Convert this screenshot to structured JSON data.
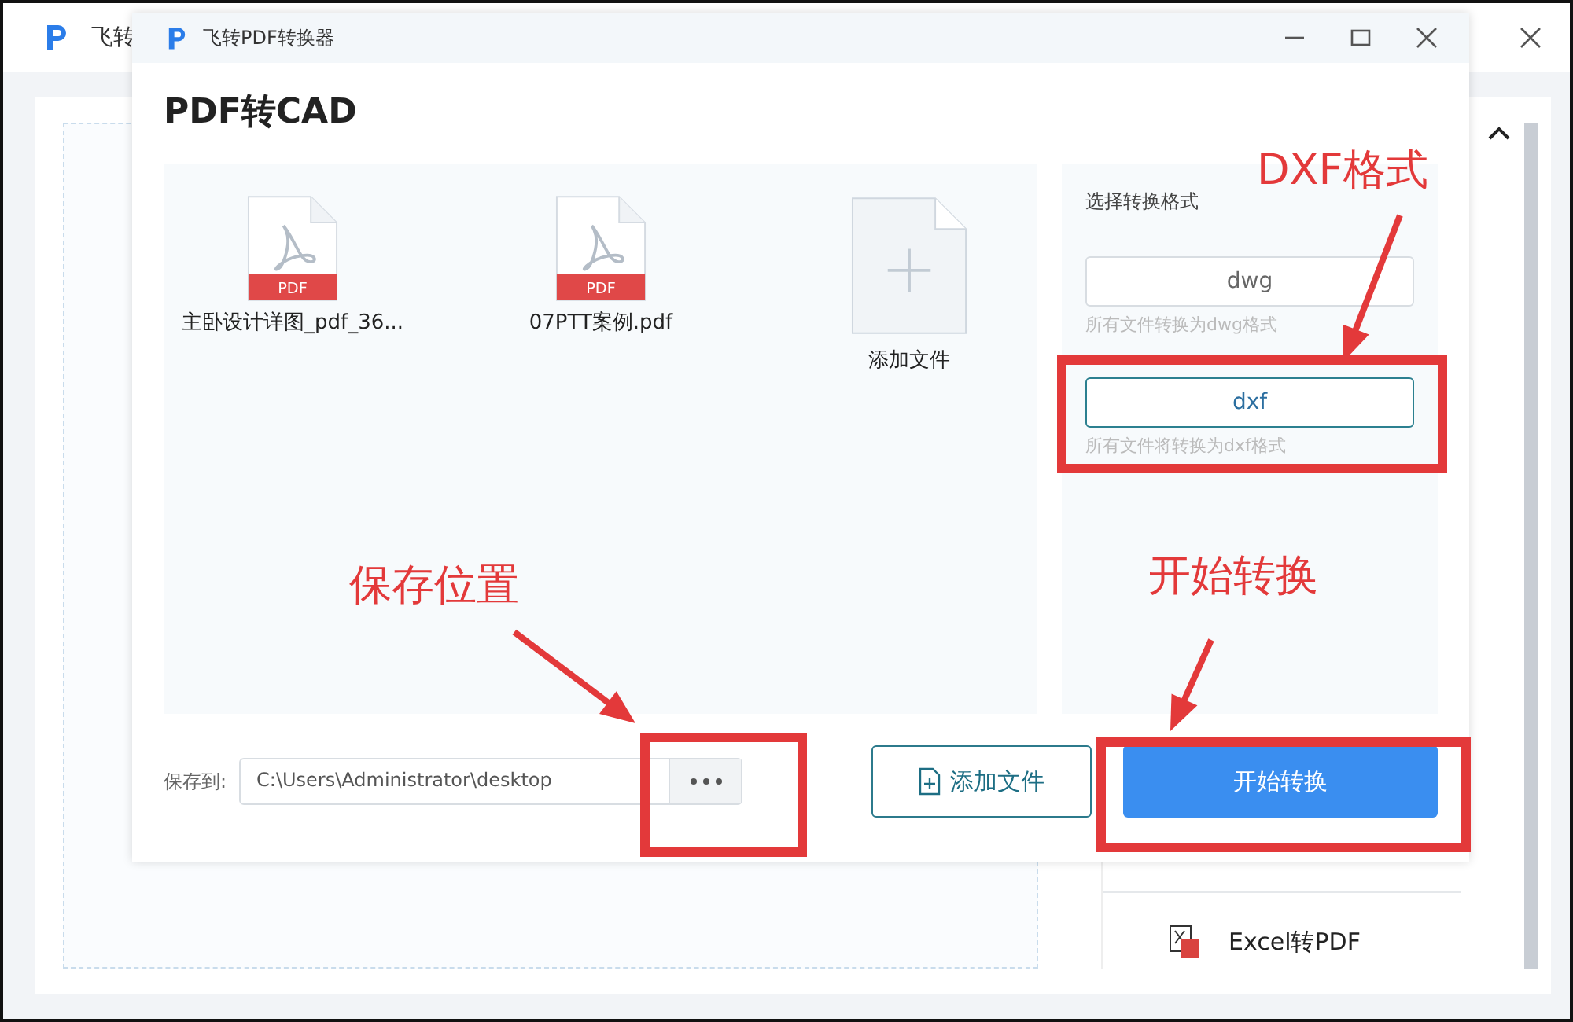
{
  "background_window": {
    "title": "飞转",
    "sidebar_items": [
      {
        "label": "Excel转PDF"
      }
    ]
  },
  "dialog": {
    "title": "飞转PDF转换器",
    "heading": "PDF转CAD"
  },
  "files": [
    {
      "name": "主卧设计详图_pdf_36...",
      "badge": "PDF"
    },
    {
      "name": "07PTT案例.pdf",
      "badge": "PDF"
    }
  ],
  "add_tile": {
    "label": "添加文件"
  },
  "format_panel": {
    "label": "选择转换格式",
    "options": [
      {
        "label": "dwg",
        "hint": "所有文件转换为dwg格式",
        "selected": false
      },
      {
        "label": "dxf",
        "hint": "所有文件将转换为dxf格式",
        "selected": true
      }
    ]
  },
  "save": {
    "label": "保存到:",
    "value": "C:\\Users\\Administrator\\desktop"
  },
  "buttons": [
    {
      "label": "添加文件",
      "kind": "secondary"
    },
    {
      "label": "开始转换",
      "kind": "primary"
    }
  ],
  "annotations": [
    {
      "text": "DXF格式"
    },
    {
      "text": "保存位置"
    },
    {
      "text": "开始转换"
    }
  ]
}
